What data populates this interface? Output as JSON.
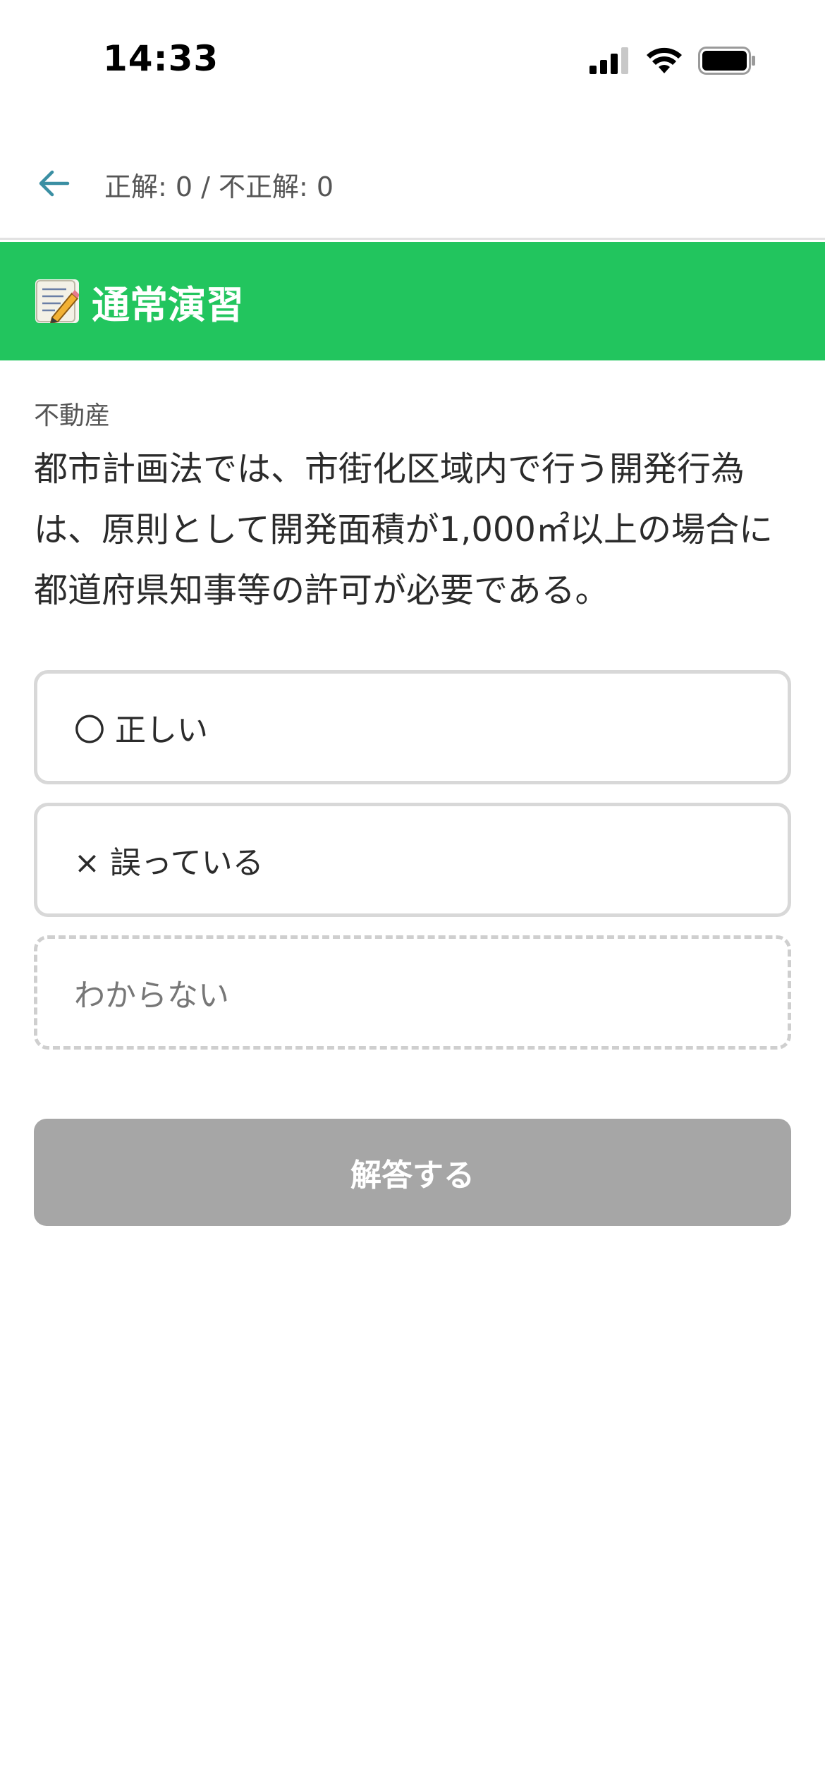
{
  "status": {
    "time": "14:33"
  },
  "header": {
    "score": "正解: 0 / 不正解: 0"
  },
  "banner": {
    "icon": "memo-icon",
    "title": "通常演習",
    "color": "#22c55e"
  },
  "question": {
    "category": "不動産",
    "text": "都市計画法では、市街化区域内で行う開発行為は、原則として開発面積が1,000㎡以上の場合に都道府県知事等の許可が必要である。"
  },
  "options": [
    {
      "label": "〇 正しい"
    },
    {
      "label": "× 誤っている"
    },
    {
      "label": "わからない"
    }
  ],
  "submit": {
    "label": "解答する",
    "state": "disabled"
  }
}
